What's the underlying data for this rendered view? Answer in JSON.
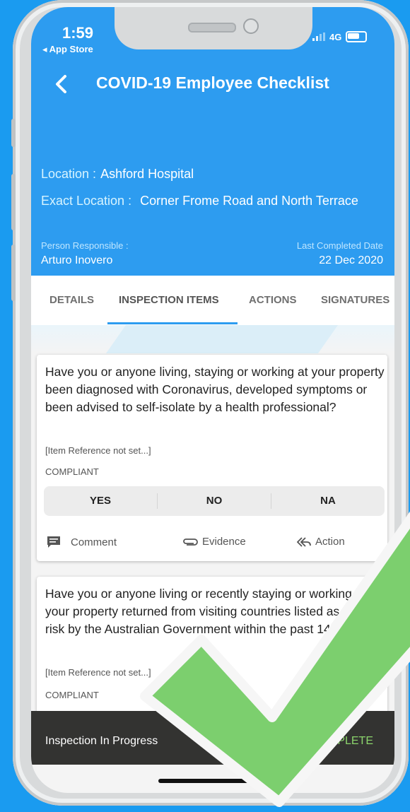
{
  "status_bar": {
    "time": "1:59",
    "back_app": "◂ App Store",
    "network": "4G"
  },
  "header": {
    "title": "COVID-19 Employee Checklist",
    "location_label": "Location :",
    "location_value": "Ashford Hospital",
    "exact_location_label": "Exact Location :",
    "exact_location_value": "Corner Frome Road and North Terrace",
    "person_responsible_label": "Person Responsible :",
    "person_responsible_value": "Arturo Inovero",
    "last_completed_label": "Last Completed Date",
    "last_completed_value": "22 Dec 2020"
  },
  "tabs": [
    {
      "label": "DETAILS"
    },
    {
      "label": "INSPECTION ITEMS",
      "active": true
    },
    {
      "label": "ACTIONS"
    },
    {
      "label": "SIGNATURES"
    }
  ],
  "items": [
    {
      "question": "Have you or anyone living, staying or working at your property been diagnosed with Coronavirus, developed symptoms or been advised to self-isolate by a health professional?",
      "reference": "[Item Reference not set...]",
      "compliance_label": "COMPLIANT",
      "options": [
        "YES",
        "NO",
        "NA"
      ],
      "comment_label": "Comment",
      "evidence_label": "Evidence",
      "action_label": "Action"
    },
    {
      "question": "Have you or anyone living or recently staying or working at your property returned from visiting countries listed as high risk by the Australian Government within the past 14 days?",
      "reference": "[Item Reference not set...]",
      "compliance_label": "COMPLIANT"
    }
  ],
  "bottom_bar": {
    "status": "Inspection In Progress",
    "action": "COMPLETE"
  },
  "colors": {
    "header": "#2d9cf0",
    "background": "#1a9bf0",
    "check": "#7ccf6e",
    "accent_green": "#8bd46c"
  }
}
